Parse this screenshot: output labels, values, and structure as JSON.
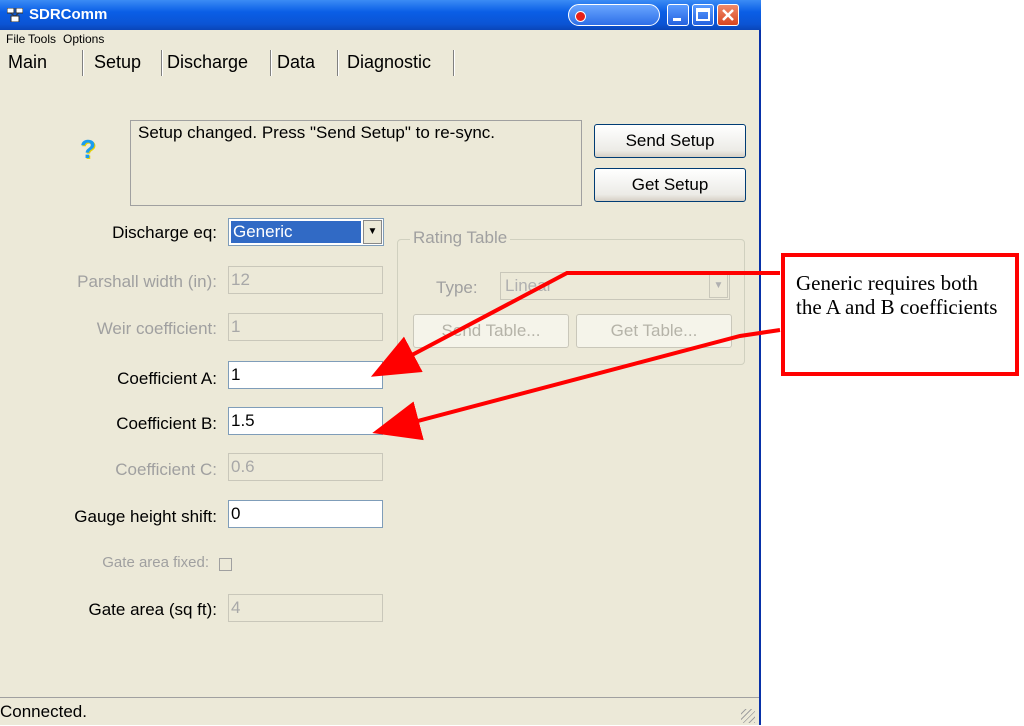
{
  "window": {
    "title": "SDRComm"
  },
  "menu": [
    "File",
    "Tools",
    "Options"
  ],
  "tabs": [
    "Main",
    "Setup",
    "Discharge",
    "Data",
    "Diagnostic"
  ],
  "message": {
    "text": "Setup changed. Press \"Send Setup\" to re-sync."
  },
  "buttons": {
    "send_setup": "Send Setup",
    "get_setup": "Get Setup",
    "send_table": "Send Table...",
    "get_table": "Get Table..."
  },
  "form": {
    "discharge_eq": {
      "label": "Discharge eq:",
      "value": "Generic"
    },
    "parshall_width": {
      "label": "Parshall width (in):",
      "value": "12"
    },
    "weir_coefficient": {
      "label": "Weir coefficient:",
      "value": "1"
    },
    "coefficient_a": {
      "label": "Coefficient A:",
      "value": "1"
    },
    "coefficient_b": {
      "label": "Coefficient B:",
      "value": "1.5"
    },
    "coefficient_c": {
      "label": "Coefficient C:",
      "value": "0.6"
    },
    "gauge_height_shift": {
      "label": "Gauge height shift:",
      "value": "0"
    },
    "gate_area_fixed": {
      "label": "Gate area fixed:",
      "checked": false
    },
    "gate_area": {
      "label": "Gate area (sq ft):",
      "value": "4"
    }
  },
  "rating_table": {
    "title": "Rating Table",
    "type_label": "Type:",
    "type_value": "Linear"
  },
  "status": {
    "text": "Connected."
  },
  "callout": {
    "text": "Generic requires both the A and B coefficients"
  },
  "colors": {
    "titlebar": "#0a5ee6",
    "selected": "#316ac5",
    "annotation": "#ff0000",
    "window_bg": "#ece9d8"
  }
}
